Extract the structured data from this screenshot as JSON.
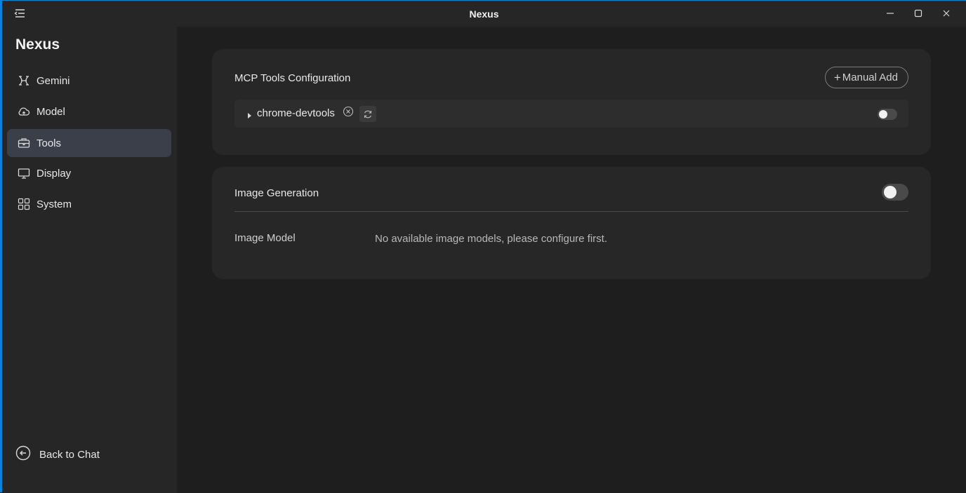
{
  "window": {
    "title": "Nexus",
    "accent_color": "#0a84d6"
  },
  "sidebar": {
    "brand": "Nexus",
    "items": [
      {
        "label": "Gemini",
        "icon": "gemini-icon"
      },
      {
        "label": "Model",
        "icon": "cloud-icon"
      },
      {
        "label": "Tools",
        "icon": "toolbox-icon",
        "active": true
      },
      {
        "label": "Display",
        "icon": "monitor-icon"
      },
      {
        "label": "System",
        "icon": "grid-icon"
      }
    ],
    "back_label": "Back to Chat"
  },
  "mcp": {
    "title": "MCP Tools Configuration",
    "add_plus": "+",
    "add_label": "Manual Add",
    "tools": [
      {
        "name": "chrome-devtools",
        "enabled": false
      }
    ]
  },
  "image_generation": {
    "title": "Image Generation",
    "enabled": false,
    "model_label": "Image Model",
    "model_value": "No available image models, please configure first."
  }
}
